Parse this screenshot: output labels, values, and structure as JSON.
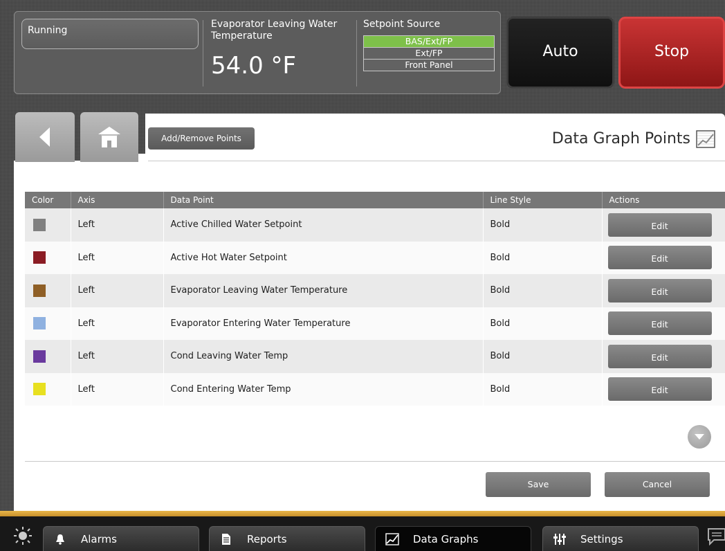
{
  "status": {
    "state": "Running",
    "evap_label": "Evaporator Leaving Water Temperature",
    "evap_value": "54.0 °F",
    "setpoint_source_title": "Setpoint Source",
    "setpoint_sources": [
      {
        "label": "BAS/Ext/FP",
        "active": true
      },
      {
        "label": "Ext/FP",
        "active": false
      },
      {
        "label": "Front Panel",
        "active": false
      }
    ],
    "auto_label": "Auto",
    "stop_label": "Stop"
  },
  "nav": {
    "back_icon": "back-arrow-icon",
    "home_icon": "home-icon"
  },
  "page": {
    "add_remove_label": "Add/Remove Points",
    "title": "Data Graph Points",
    "title_icon": "data-graph-icon"
  },
  "table": {
    "headers": [
      "Color",
      "Axis",
      "Data Point",
      "Line Style",
      "Actions"
    ],
    "rows": [
      {
        "color": "#808080",
        "axis": "Left",
        "point": "Active Chilled Water Setpoint",
        "style": "Bold",
        "action": "Edit"
      },
      {
        "color": "#8b1c24",
        "axis": "Left",
        "point": "Active Hot Water Setpoint",
        "style": "Bold",
        "action": "Edit"
      },
      {
        "color": "#8f5f26",
        "axis": "Left",
        "point": "Evaporator Leaving Water Temperature",
        "style": "Bold",
        "action": "Edit"
      },
      {
        "color": "#8fb1e0",
        "axis": "Left",
        "point": "Evaporator Entering Water Temperature",
        "style": "Bold",
        "action": "Edit"
      },
      {
        "color": "#6a3a9e",
        "axis": "Left",
        "point": "Cond Leaving Water Temp",
        "style": "Bold",
        "action": "Edit"
      },
      {
        "color": "#e8e020",
        "axis": "Left",
        "point": "Cond Entering Water Temp",
        "style": "Bold",
        "action": "Edit"
      }
    ]
  },
  "footer": {
    "save_label": "Save",
    "cancel_label": "Cancel"
  },
  "bottom_nav": {
    "alarms": "Alarms",
    "reports": "Reports",
    "data_graphs": "Data Graphs",
    "settings": "Settings"
  }
}
